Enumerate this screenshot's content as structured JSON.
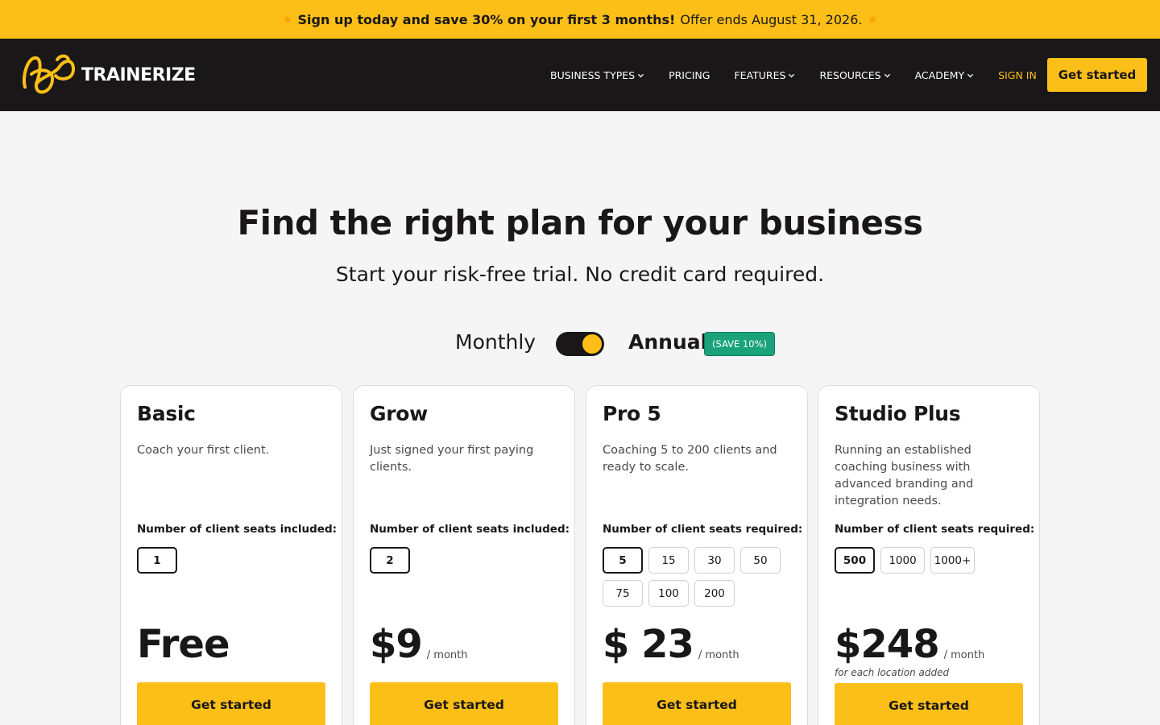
{
  "promo": {
    "bold": "Sign up today and save 30% on your first 3 months!",
    "rest": "Offer ends August 31, 2026.",
    "icon": "star-icon"
  },
  "nav": {
    "brand": "TRAINERIZE",
    "links": [
      {
        "label": "BUSINESS TYPES",
        "dropdown": true
      },
      {
        "label": "PRICING",
        "dropdown": false
      },
      {
        "label": "FEATURES",
        "dropdown": true
      },
      {
        "label": "RESOURCES",
        "dropdown": true
      },
      {
        "label": "ACADEMY",
        "dropdown": true
      },
      {
        "label": "SIGN IN",
        "dropdown": false
      }
    ],
    "cta": "Get started"
  },
  "hero": {
    "title": "Find the right plan for your business",
    "subtitle": "Start your risk-free trial. No credit card required."
  },
  "billing": {
    "monthly": "Monthly",
    "annual": "Annual",
    "badge": "(SAVE 10%)",
    "selected": "Annual"
  },
  "plans": [
    {
      "name": "Basic",
      "desc": "Coach your first client.",
      "seats_label": "Number of client seats included:",
      "seats": [
        "1"
      ],
      "selected_seat": "1",
      "price": "Free",
      "per": "",
      "note": "",
      "cta": "Get started"
    },
    {
      "name": "Grow",
      "desc": "Just signed your first paying clients.",
      "seats_label": "Number of client seats included:",
      "seats": [
        "2"
      ],
      "selected_seat": "2",
      "price": "$9",
      "per": "/ month",
      "note": "",
      "cta": "Get started"
    },
    {
      "name": "Pro 5",
      "desc": "Coaching 5 to 200 clients and ready to scale.",
      "seats_label": "Number of client seats required:",
      "seats": [
        "5",
        "15",
        "30",
        "50",
        "75",
        "100",
        "200"
      ],
      "selected_seat": "5",
      "price": "$ 23",
      "per": "/ month",
      "note": "",
      "cta": "Get started"
    },
    {
      "name": "Studio Plus",
      "desc": "Running an established coaching business with advanced branding and integration needs.",
      "seats_label": "Number of client seats required:",
      "seats": [
        "500",
        "1000",
        "1000+"
      ],
      "selected_seat": "500",
      "price": "$248",
      "per": "/ month",
      "note": "for each location added",
      "cta": "Get started"
    }
  ],
  "colors": {
    "accent": "#fcbf17",
    "dark": "#1a1718",
    "badge": "#1aa37a",
    "background": "#f5f5f6"
  }
}
